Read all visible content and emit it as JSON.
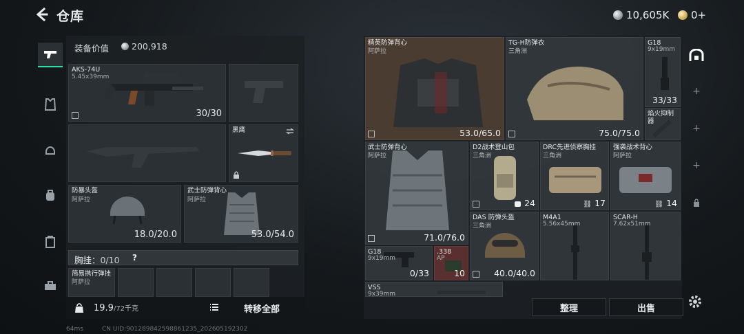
{
  "header": {
    "title": "仓库",
    "silver": "10,605K",
    "gold": "0+"
  },
  "equipment": {
    "value_label": "装备价值",
    "value": "200,918",
    "primary": {
      "name": "AKS-74U",
      "sub": "5.45x39mm",
      "ammo": "30/30"
    },
    "melee": {
      "name": "黑鹰"
    },
    "helmet": {
      "name": "防暴头盔",
      "sub": "阿萨拉",
      "durability": "18.0/20.0"
    },
    "armor": {
      "name": "武士防弹背心",
      "sub": "阿萨拉",
      "durability": "53.0/54.0"
    },
    "rig_label": "胸挂：",
    "rig_capacity": "0/10",
    "rig_help": "?",
    "rig_item": {
      "name": "简易携行弹挂",
      "sub": "阿萨拉"
    },
    "weight": "19.9",
    "weight_max": "/72千克",
    "transfer_all": "转移全部"
  },
  "stash": {
    "items": [
      {
        "name": "精英防弹背心",
        "sub": "阿萨拉",
        "value": "53.0/65.0"
      },
      {
        "name": "TG-H防弹衣",
        "sub": "三角洲",
        "value": "75.0/75.0"
      },
      {
        "name": "G18",
        "sub": "9x19mm",
        "value": "33/33"
      },
      {
        "name": "焰火抑制器",
        "sub": "",
        "value": ""
      },
      {
        "name": "武士防弹背心",
        "sub": "阿萨拉",
        "value": "71.0/76.0"
      },
      {
        "name": "D2战术登山包",
        "sub": "三角洲",
        "value": "24"
      },
      {
        "name": "DRC先进侦察胸挂",
        "sub": "三角洲",
        "value": "17"
      },
      {
        "name": "强袭战术背心",
        "sub": "阿萨拉",
        "value": "14"
      },
      {
        "name": "DAS 防弹头盔",
        "sub": "三角洲",
        "value": "40.0/40.0"
      },
      {
        "name": "M4A1",
        "sub": "5.56x45mm",
        "value": ""
      },
      {
        "name": "SCAR-H",
        "sub": "7.62x51mm",
        "value": ""
      },
      {
        "name": "G18",
        "sub": "9x19mm",
        "value": "0/33"
      },
      {
        "name": ".338",
        "sub": "AP",
        "value": "10"
      },
      {
        "name": "VSS",
        "sub": "9x39mm",
        "value": ""
      }
    ],
    "sort_label": "整理",
    "sell_label": "出售"
  },
  "footer": {
    "ping": "64ms",
    "uid": "CN UID:901289842598861235_202605192302"
  },
  "icons": [
    "back-icon",
    "pistol-icon",
    "armor-icon",
    "helmet-icon",
    "backpack-icon",
    "case-icon",
    "toolbox-icon",
    "lock-icon",
    "list-icon",
    "gear-icon",
    "safe-box-icon",
    "plus-icon"
  ]
}
